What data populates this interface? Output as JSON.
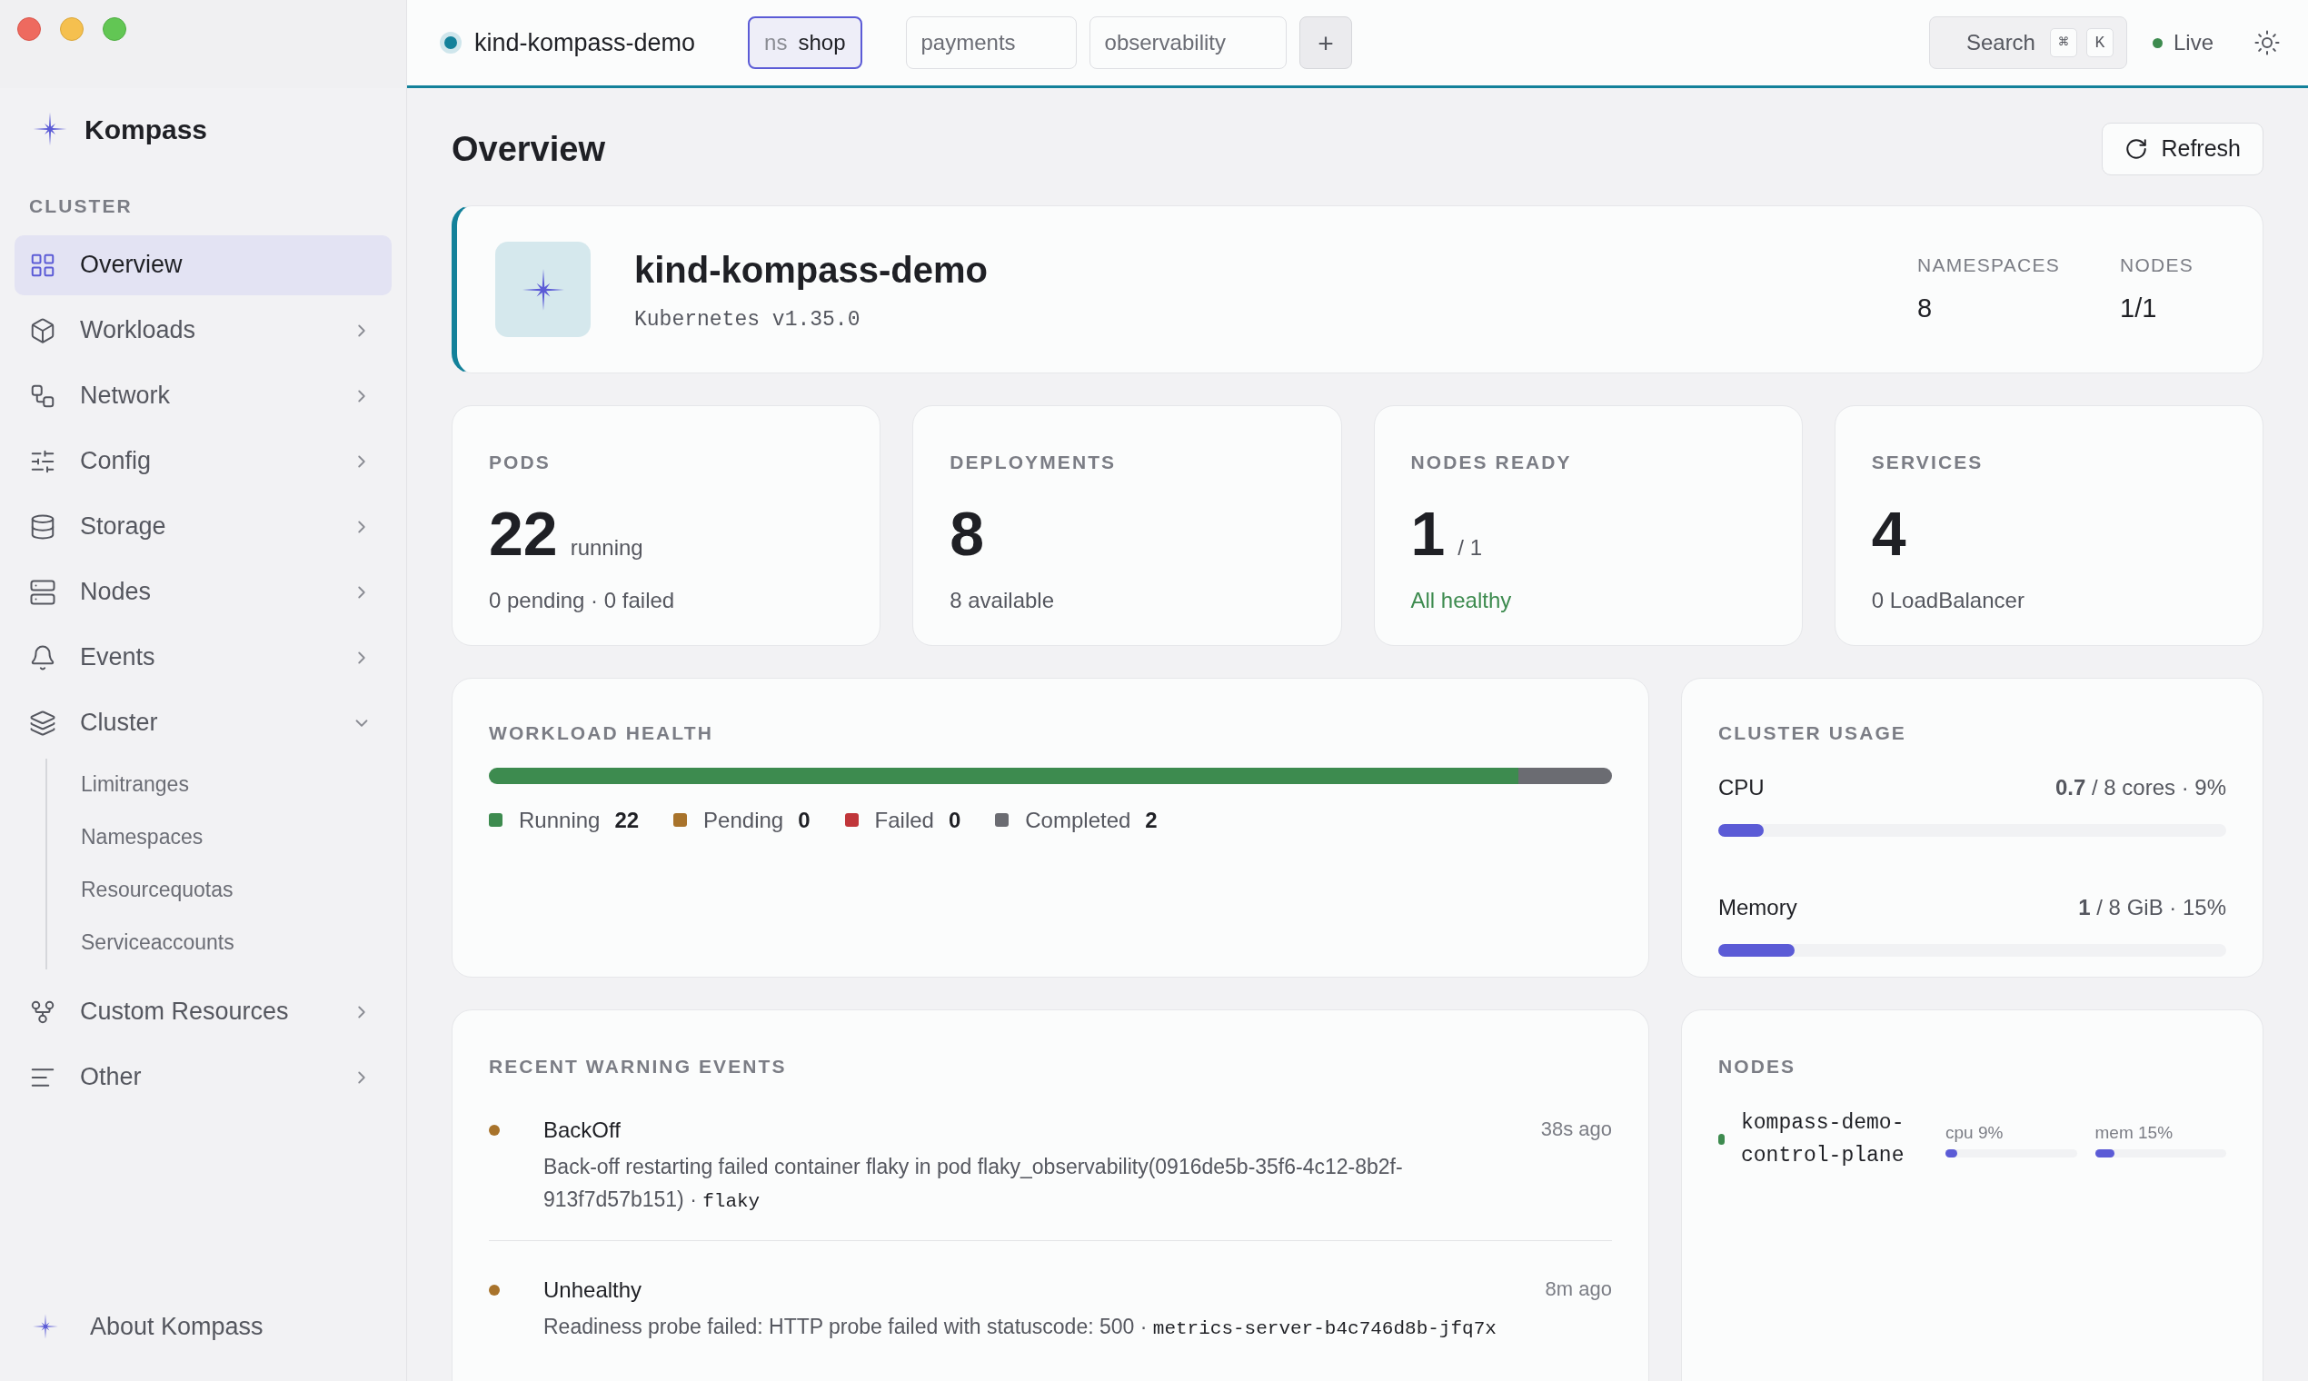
{
  "topbar": {
    "cluster": "kind-kompass-demo",
    "namespaces": [
      {
        "prefix": "ns",
        "name": "shop",
        "selected": true
      },
      {
        "name": "payments",
        "selected": false
      },
      {
        "name": "observability",
        "selected": false
      }
    ],
    "add_button": "+",
    "search": {
      "label": "Search",
      "keys": [
        "⌘",
        "K"
      ]
    },
    "live": {
      "label": "Live",
      "on": true
    }
  },
  "sidebar": {
    "brand": "Kompass",
    "section": "CLUSTER",
    "items": [
      {
        "label": "Overview",
        "selected": true
      },
      {
        "label": "Workloads",
        "selected": false,
        "expanded": false
      },
      {
        "label": "Network",
        "selected": false,
        "expanded": false
      },
      {
        "label": "Config",
        "selected": false,
        "expanded": false
      },
      {
        "label": "Storage",
        "selected": false,
        "expanded": false
      },
      {
        "label": "Nodes",
        "selected": false,
        "expanded": false
      },
      {
        "label": "Events",
        "selected": false,
        "expanded": false
      },
      {
        "label": "Cluster",
        "selected": false,
        "expanded": true,
        "children": [
          {
            "label": "Limitranges",
            "selected": false
          },
          {
            "label": "Namespaces",
            "selected": false
          },
          {
            "label": "Resourcequotas",
            "selected": false
          },
          {
            "label": "Serviceaccounts",
            "selected": false
          }
        ]
      },
      {
        "label": "Custom Resources",
        "selected": false,
        "expanded": false
      },
      {
        "label": "Other",
        "selected": false,
        "expanded": false
      }
    ],
    "footer": "About Kompass"
  },
  "page": {
    "title": "Overview",
    "refresh_button": "Refresh"
  },
  "cluster_card": {
    "name": "kind-kompass-demo",
    "version": "Kubernetes v1.35.0",
    "stats": [
      {
        "label": "NAMESPACES",
        "value": "8"
      },
      {
        "label": "NODES",
        "value": "1/1"
      }
    ]
  },
  "stat_cards": [
    {
      "label": "PODS",
      "value": "22",
      "unit": "running",
      "detail": "0 pending · 0 failed",
      "healthy": false
    },
    {
      "label": "DEPLOYMENTS",
      "value": "8",
      "detail": "8 available",
      "healthy": false
    },
    {
      "label": "NODES READY",
      "value": "1",
      "unit": "/ 1",
      "detail": "All healthy",
      "healthy": true
    },
    {
      "label": "SERVICES",
      "value": "4",
      "detail": "0 LoadBalancer",
      "healthy": false
    }
  ],
  "workload_health": {
    "title": "WORKLOAD HEALTH",
    "statuses": [
      {
        "label": "Running",
        "count": "22",
        "color": "#3d8b4f"
      },
      {
        "label": "Pending",
        "count": "0",
        "color": "#a8732b"
      },
      {
        "label": "Failed",
        "count": "0",
        "color": "#c0363a"
      },
      {
        "label": "Completed",
        "count": "2",
        "color": "#6b6c72"
      }
    ]
  },
  "cluster_usage": {
    "title": "CLUSTER USAGE",
    "resources": [
      {
        "label": "CPU",
        "reading": "**0.7** / 8 cores · 9%",
        "level": 0.09
      },
      {
        "label": "Memory",
        "reading": "**1** / 8 GiB · 15%",
        "level": 0.15
      }
    ]
  },
  "events": {
    "title": "RECENT WARNING EVENTS",
    "items": [
      {
        "reason": "BackOff",
        "message": "Back-off restarting failed container flaky in pod flaky_observability(0916de5b-35f6-4c12-8b2f-913f7d57b151) ·",
        "object": "flaky",
        "age": "38s ago",
        "color": "#a8732b"
      },
      {
        "reason": "Unhealthy",
        "message": "Readiness probe failed: HTTP probe failed with statuscode: 500 ·",
        "object": "metrics-server-b4c746d8b-jfq7x",
        "age": "8m ago",
        "color": "#a8732b"
      }
    ]
  },
  "nodes": {
    "title": "NODES",
    "items": [
      {
        "name": "kompass-demo-control-plane",
        "ready": true,
        "metrics": [
          {
            "label": "cpu 9%",
            "level": 0.09
          },
          {
            "label": "mem 15%",
            "level": 0.15
          }
        ]
      }
    ]
  }
}
